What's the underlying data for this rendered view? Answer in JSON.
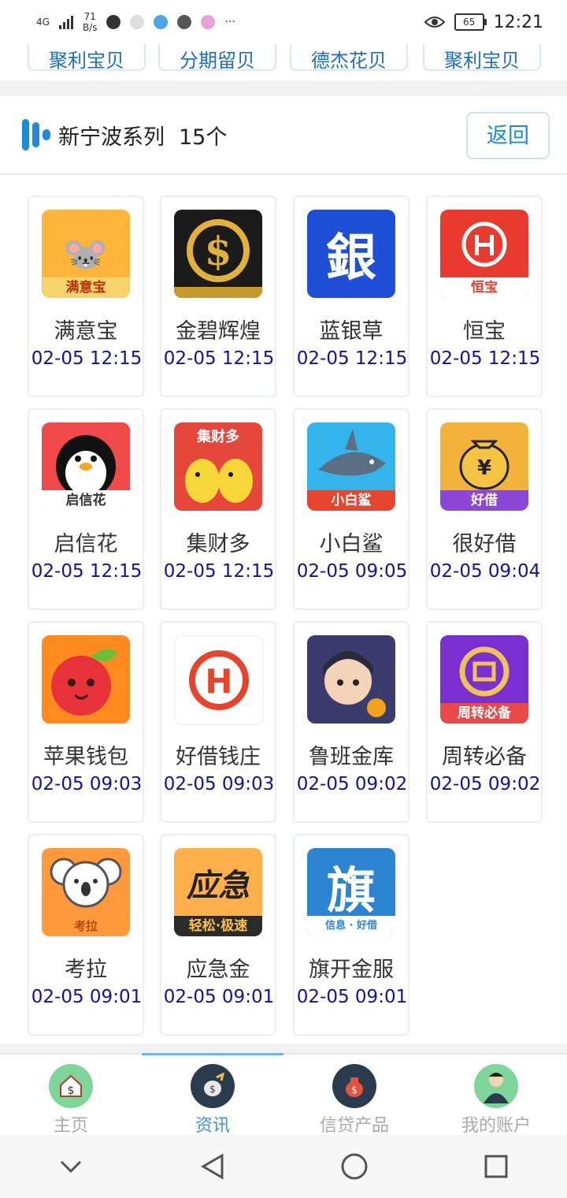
{
  "status": {
    "net_type": "4G",
    "speed_value": "71",
    "speed_unit": "B/s",
    "battery": "65",
    "time": "12:21",
    "more": "···"
  },
  "top_strip": [
    "聚利宝贝",
    "分期留贝",
    "德杰花贝",
    "聚利宝贝"
  ],
  "series": {
    "title": "新宁波系列",
    "count": "15个",
    "back": "返回"
  },
  "apps": [
    {
      "name": "满意宝",
      "time": "02-05 12:15",
      "badge": "满意宝",
      "glyph": "",
      "bg": "#ffb43a"
    },
    {
      "name": "金碧辉煌",
      "time": "02-05 12:15",
      "badge": "",
      "glyph": "$",
      "bg": "#1b1b1b"
    },
    {
      "name": "蓝银草",
      "time": "02-05 12:15",
      "badge": "",
      "glyph": "銀",
      "bg": "#1f4fd6"
    },
    {
      "name": "恒宝",
      "time": "02-05 12:15",
      "badge": "恒宝",
      "glyph": "",
      "bg": "#e83a2f"
    },
    {
      "name": "启信花",
      "time": "02-05 12:15",
      "badge": "启信花",
      "glyph": "",
      "bg": "#f04a4a"
    },
    {
      "name": "集财多",
      "time": "02-05 12:15",
      "badge": "",
      "glyph": "集财多",
      "bg": "#e5473a"
    },
    {
      "name": "小白鲨",
      "time": "02-05 09:05",
      "badge": "小白鲨",
      "glyph": "",
      "bg": "#33b5ec"
    },
    {
      "name": "很好借",
      "time": "02-05 09:04",
      "badge": "好借",
      "glyph": "¥",
      "bg": "#f3b23a"
    },
    {
      "name": "苹果钱包",
      "time": "02-05 09:03",
      "badge": "",
      "glyph": "",
      "bg": "#ff8a1e"
    },
    {
      "name": "好借钱庄",
      "time": "02-05 09:03",
      "badge": "",
      "glyph": "H",
      "bg": "#ffffff"
    },
    {
      "name": "鲁班金库",
      "time": "02-05 09:02",
      "badge": "",
      "glyph": "",
      "bg": "#3b3b6e"
    },
    {
      "name": "周转必备",
      "time": "02-05 09:02",
      "badge": "周转必备",
      "glyph": "",
      "bg": "#7a2fd0"
    },
    {
      "name": "考拉",
      "time": "02-05 09:01",
      "badge": "考拉",
      "glyph": "",
      "bg": "#ff9a3c"
    },
    {
      "name": "应急金",
      "time": "02-05 09:01",
      "badge": "轻松·极速",
      "glyph": "应急",
      "bg": "#ffb04a"
    },
    {
      "name": "旗开金服",
      "time": "02-05 09:01",
      "badge": "信息 · 好借",
      "glyph": "旗",
      "bg": "#2b84d2"
    }
  ],
  "tabs": [
    {
      "label": "主页",
      "icon": "house-dollar-icon",
      "color": "#6fcf8e"
    },
    {
      "label": "资讯",
      "icon": "money-bag-icon",
      "color": "#2a3b4d"
    },
    {
      "label": "信贷产品",
      "icon": "money-sack-icon",
      "color": "#2a3b4d"
    },
    {
      "label": "我的账户",
      "icon": "user-avatar-icon",
      "color": "#6fcf8e"
    }
  ],
  "colors": {
    "accent": "#1a8ae0",
    "time_text": "#1010a6",
    "active_tab": "#3a96e0"
  }
}
